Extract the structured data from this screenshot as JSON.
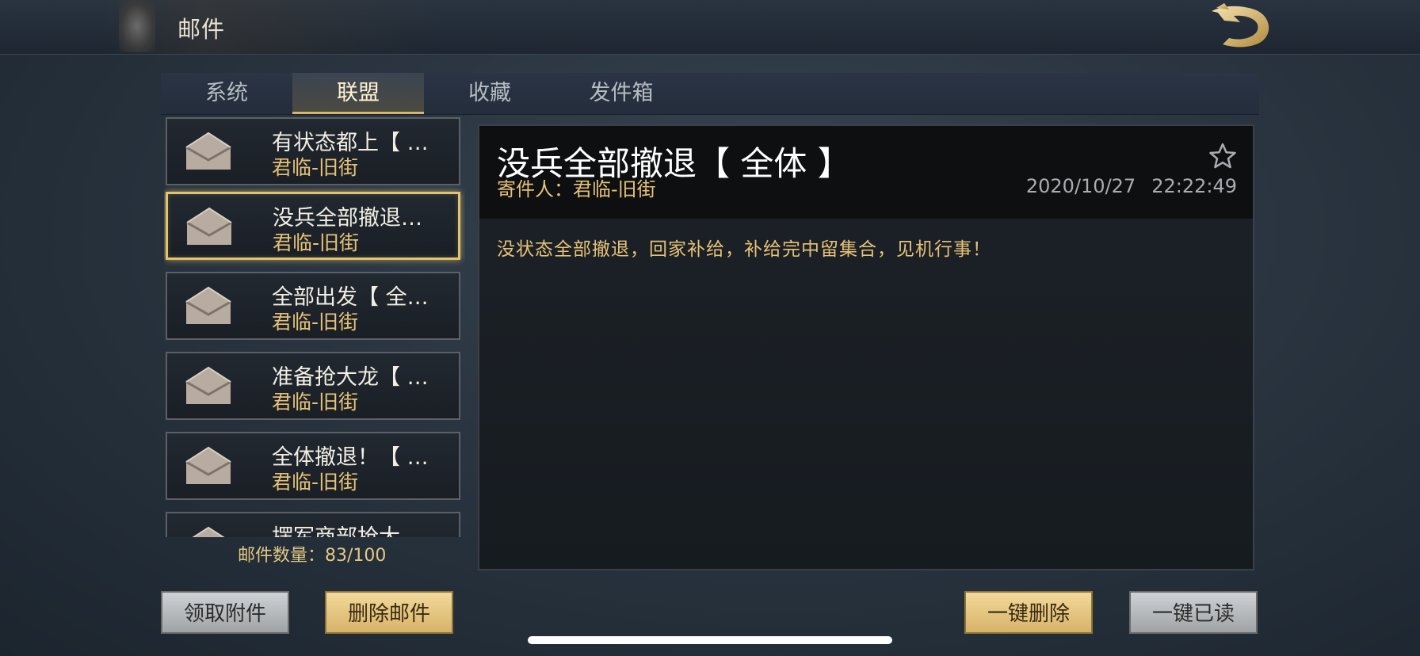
{
  "header": {
    "title": "邮件",
    "logo_icon": "dragon-logo-icon"
  },
  "tabs": [
    {
      "label": "系统",
      "active": false
    },
    {
      "label": "联盟",
      "active": true
    },
    {
      "label": "收藏",
      "active": false
    },
    {
      "label": "发件箱",
      "active": false
    }
  ],
  "mail_list": [
    {
      "subject": "有状态都上【 …",
      "sender": "君临-旧街",
      "selected": false
    },
    {
      "subject": "没兵全部撤退…",
      "sender": "君临-旧街",
      "selected": true
    },
    {
      "subject": "全部出发【 全…",
      "sender": "君临-旧街",
      "selected": false
    },
    {
      "subject": "准备抢大龙【 …",
      "sender": "君临-旧街",
      "selected": false
    },
    {
      "subject": "全体撤退！【 …",
      "sender": "君临-旧街",
      "selected": false
    },
    {
      "subject": "摆军商部抢大",
      "sender": "",
      "selected": false
    }
  ],
  "mail_count": "邮件数量：83/100",
  "detail": {
    "subject": "没兵全部撤退【 全体 】",
    "sender": "寄件人：君临-旧街",
    "date": "2020/10/27",
    "time": "22:22:49",
    "body": "没状态全部撤退，回家补给，补给完中留集合，见机行事！",
    "favorite_icon": "star-outline-icon"
  },
  "buttons": {
    "claim_attachments": "领取附件",
    "delete_mail": "删除邮件",
    "delete_all": "一键删除",
    "read_all": "一键已读"
  },
  "colors": {
    "accent_gold": "#e5c277",
    "selected_border": "#e2c36e",
    "background": "#2b3642"
  }
}
